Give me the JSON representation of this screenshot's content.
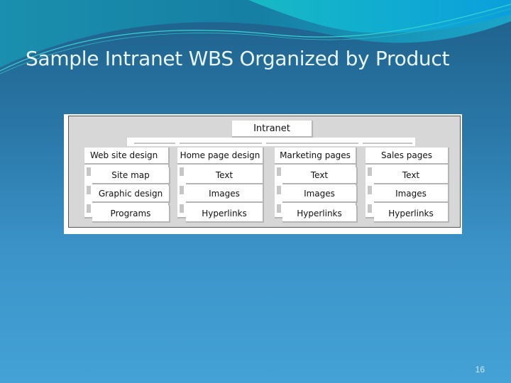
{
  "slide": {
    "title": "Sample Intranet WBS Organized by Product",
    "page_number": "16",
    "colors": {
      "background_top": "#1e5f8a",
      "background_bottom": "#44a2d6",
      "title_text": "#e8f6fb",
      "wave_accent": "#1fc0c8"
    }
  },
  "wbs": {
    "root": "Intranet",
    "groups": [
      {
        "label": "Web site design",
        "children": [
          "Site map",
          "Graphic design",
          "Programs"
        ]
      },
      {
        "label": "Home page design",
        "children": [
          "Text",
          "Images",
          "Hyperlinks"
        ]
      },
      {
        "label": "Marketing pages",
        "children": [
          "Text",
          "Images",
          "Hyperlinks"
        ]
      },
      {
        "label": "Sales pages",
        "children": [
          "Text",
          "Images",
          "Hyperlinks"
        ]
      }
    ]
  }
}
